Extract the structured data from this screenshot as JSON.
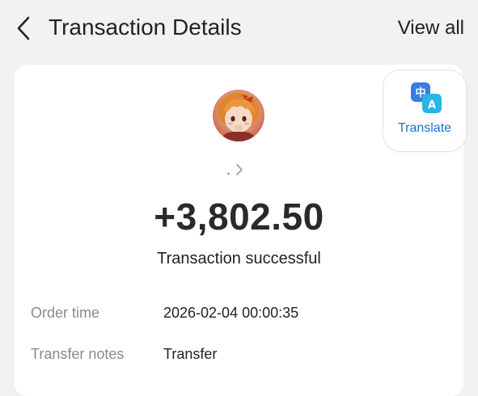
{
  "header": {
    "title": "Transaction Details",
    "view_all": "View all"
  },
  "translate": {
    "label": "Translate",
    "icon_glyph_zh": "中",
    "icon_glyph_en": "A"
  },
  "payee": {
    "name": "."
  },
  "transaction": {
    "amount": "+3,802.50",
    "status": "Transaction successful"
  },
  "details": [
    {
      "label": "Order time",
      "value": "2026-02-04 00:00:35"
    },
    {
      "label": "Transfer notes",
      "value": "Transfer"
    }
  ],
  "colors": {
    "accent": "#1a6fd1",
    "background": "#f2f2f2",
    "card": "#ffffff"
  },
  "icons": {
    "back": "chevron-left-icon",
    "forward": "chevron-right-icon",
    "translate": "translate-icon"
  }
}
